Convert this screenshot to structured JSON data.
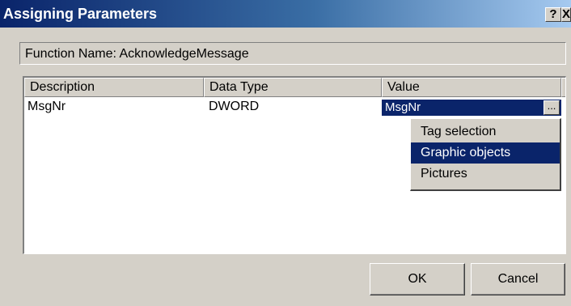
{
  "window": {
    "title": "Assigning Parameters",
    "help_label": "?",
    "close_label": "X"
  },
  "function_name": {
    "label": "Function Name: AcknowledgeMessage"
  },
  "table": {
    "columns": [
      "Description",
      "Data Type",
      "Value"
    ],
    "rows": [
      {
        "description": "MsgNr",
        "data_type": "DWORD",
        "value": "MsgNr"
      }
    ],
    "browse_label": "..."
  },
  "context_menu": {
    "items": [
      "Tag selection",
      "Graphic objects",
      "Pictures"
    ],
    "selected": "Graphic objects"
  },
  "buttons": {
    "ok": "OK",
    "cancel": "Cancel"
  },
  "colors": {
    "title_bar": "#0a246a",
    "selection": "#0a246a",
    "face": "#d4d0c8"
  }
}
